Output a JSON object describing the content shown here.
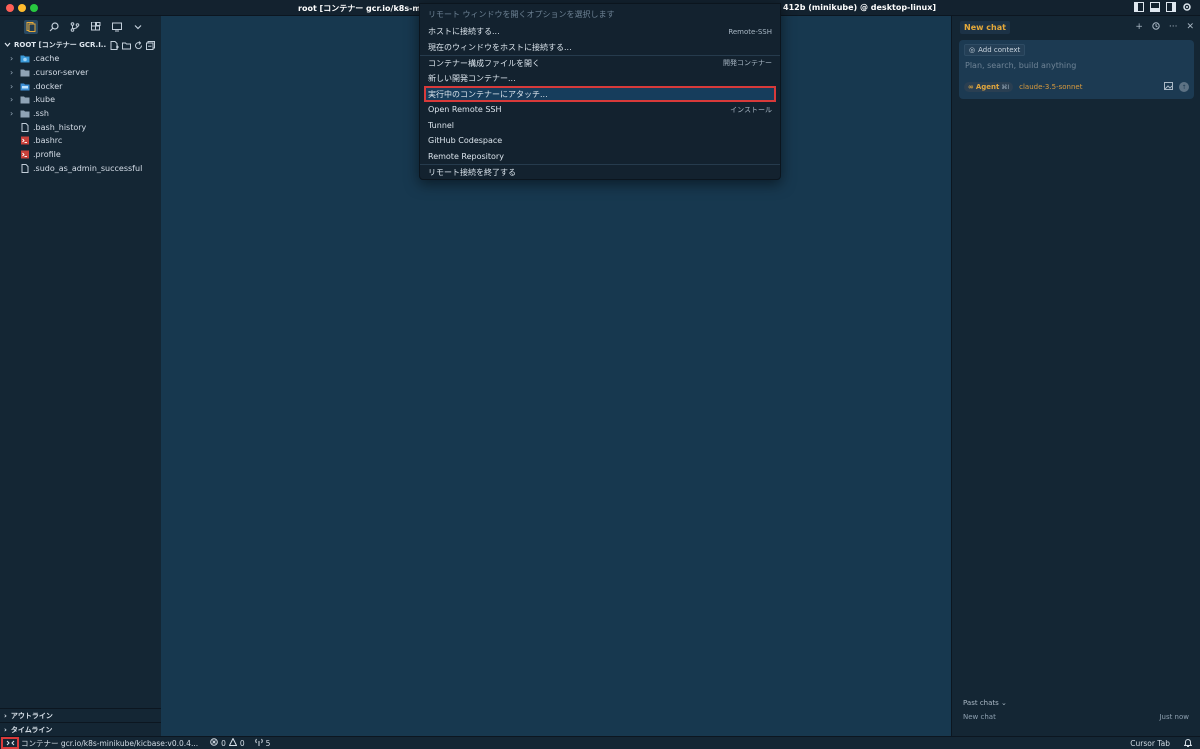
{
  "window": {
    "title_left": "root [コンテナー gcr.io/k8s-minikube",
    "title_right": "412b (minikube) @ desktop-linux]"
  },
  "explorer": {
    "header": "ROOT [コンテナー GCR.I...",
    "items": [
      {
        "label": ".cache",
        "type": "folder",
        "icon": "folder-cache-icon"
      },
      {
        "label": ".cursor-server",
        "type": "folder",
        "icon": "folder-icon"
      },
      {
        "label": ".docker",
        "type": "folder",
        "icon": "folder-docker-icon"
      },
      {
        "label": ".kube",
        "type": "folder",
        "icon": "folder-icon"
      },
      {
        "label": ".ssh",
        "type": "folder",
        "icon": "folder-icon"
      },
      {
        "label": ".bash_history",
        "type": "file",
        "icon": "file-icon"
      },
      {
        "label": ".bashrc",
        "type": "file",
        "icon": "shell-file-icon"
      },
      {
        "label": ".profile",
        "type": "file",
        "icon": "shell-file-icon"
      },
      {
        "label": ".sudo_as_admin_successful",
        "type": "file",
        "icon": "file-icon"
      }
    ],
    "outline": "アウトライン",
    "timeline": "タイムライン"
  },
  "palette": {
    "placeholder": "リモート ウィンドウを開くオプションを選択します",
    "items": [
      {
        "label": "ホストに接続する...",
        "hint": "Remote-SSH"
      },
      {
        "label": "現在のウィンドウをホストに接続する...",
        "hint": ""
      },
      {
        "label": "コンテナー構成ファイルを開く",
        "hint": "開発コンテナー"
      },
      {
        "label": "新しい開発コンテナー...",
        "hint": ""
      },
      {
        "label": "実行中のコンテナーにアタッチ...",
        "hint": ""
      },
      {
        "label": "Open Remote SSH",
        "hint": "インストール"
      },
      {
        "label": "Tunnel",
        "hint": ""
      },
      {
        "label": "GitHub Codespace",
        "hint": ""
      },
      {
        "label": "Remote Repository",
        "hint": ""
      },
      {
        "label": "リモート接続を終了する",
        "hint": ""
      }
    ]
  },
  "chat": {
    "tab": "New chat",
    "add_context": "Add context",
    "placeholder": "Plan, search, build anything",
    "agent": "Agent",
    "agent_kbd": "⌘I",
    "model": "claude-3.5-sonnet",
    "past_chats": "Past chats",
    "past_item": "New chat",
    "past_time": "Just now"
  },
  "status": {
    "remote": "コンテナー gcr.io/k8s-minikube/kicbase:v0.0.4...",
    "errors": "0",
    "warnings": "0",
    "ports": "5",
    "cursor_tab": "Cursor Tab"
  },
  "colors": {
    "highlight_border": "#d83a3a",
    "accent": "#e5a93a",
    "editor_bg": "#17384f"
  }
}
